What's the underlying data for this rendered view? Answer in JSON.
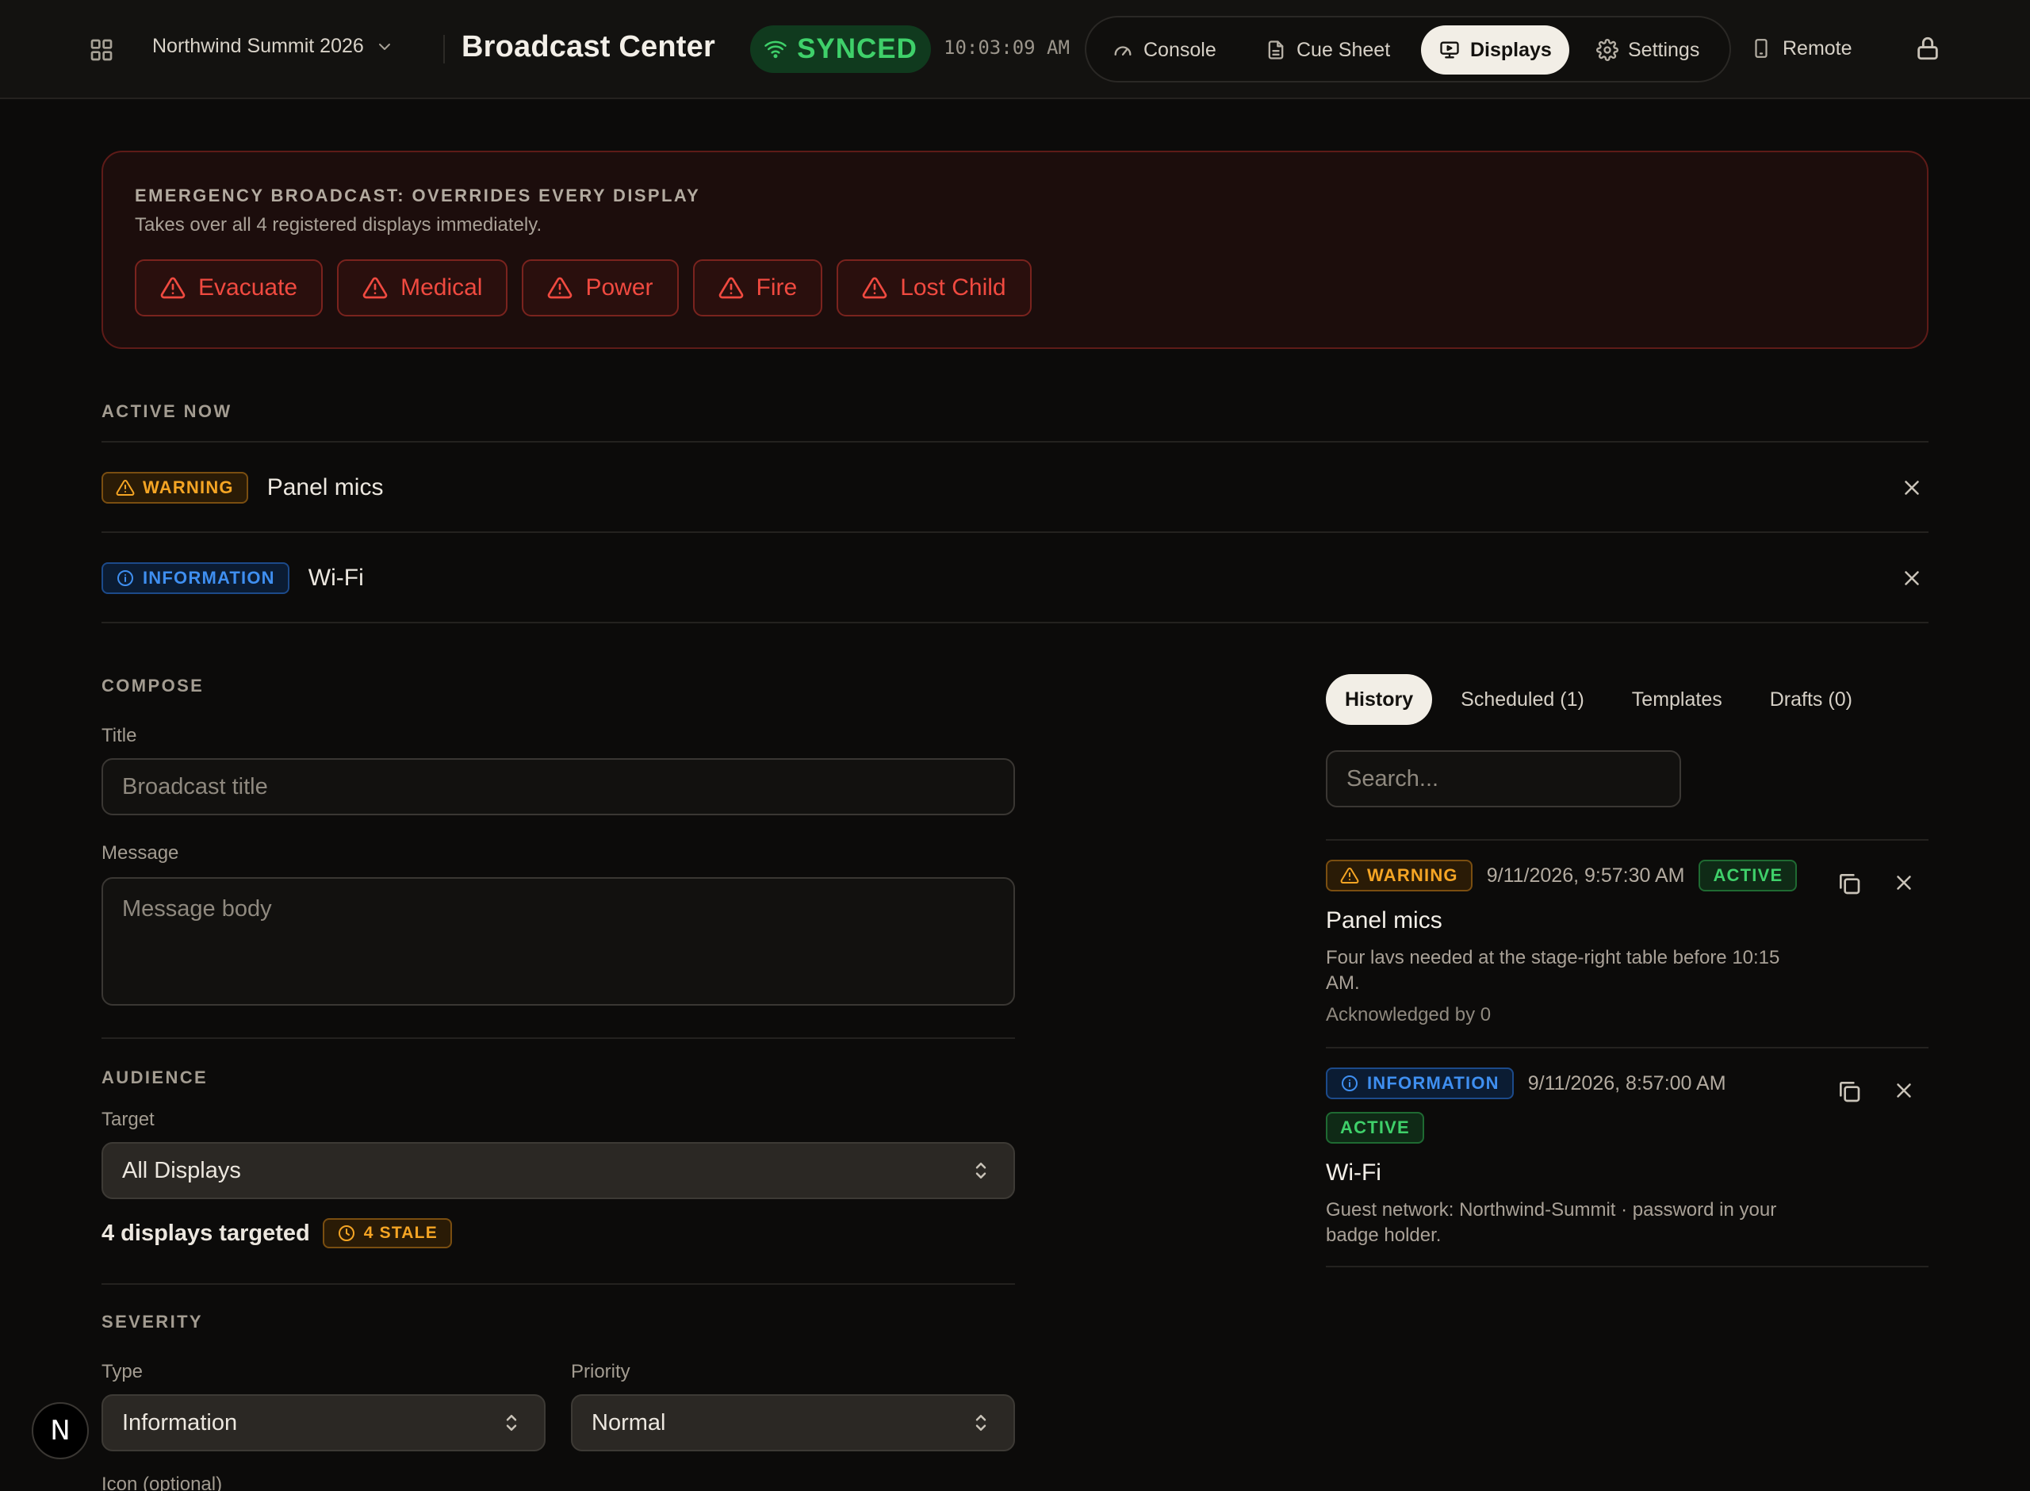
{
  "topbar": {
    "event_name": "Northwind Summit 2026",
    "title": "Broadcast Center",
    "sync_status": "SYNCED",
    "clock": "10:03:09 AM",
    "nav": [
      {
        "label": "Console",
        "icon": "gauge-icon"
      },
      {
        "label": "Cue Sheet",
        "icon": "document-icon"
      },
      {
        "label": "Displays",
        "icon": "monitor-icon",
        "active": true
      },
      {
        "label": "Settings",
        "icon": "gear-icon"
      }
    ],
    "remote_label": "Remote"
  },
  "emergency": {
    "title": "EMERGENCY BROADCAST: OVERRIDES EVERY DISPLAY",
    "subtitle": "Takes over all 4 registered displays immediately.",
    "buttons": [
      "Evacuate",
      "Medical",
      "Power",
      "Fire",
      "Lost Child"
    ],
    "color": "#f04a40"
  },
  "active_now": {
    "label": "ACTIVE NOW",
    "items": [
      {
        "badge": "WARNING",
        "name": "Panel mics"
      },
      {
        "badge": "INFORMATION",
        "name": "Wi-Fi"
      }
    ]
  },
  "compose": {
    "label": "COMPOSE",
    "title_label": "Title",
    "title_placeholder": "Broadcast title",
    "message_label": "Message",
    "message_placeholder": "Message body"
  },
  "audience": {
    "label": "AUDIENCE",
    "target_label": "Target",
    "target_value": "All Displays",
    "targeted_text": "4 displays targeted",
    "stale_badge": "4 STALE"
  },
  "severity": {
    "label": "SEVERITY",
    "type_label": "Type",
    "type_value": "Information",
    "priority_label": "Priority",
    "priority_value": "Normal",
    "icon_label": "Icon (optional)"
  },
  "history_panel": {
    "tabs": [
      "History",
      "Scheduled (1)",
      "Templates",
      "Drafts (0)"
    ],
    "search_placeholder": "Search...",
    "items": [
      {
        "badge": "WARNING",
        "time": "9/11/2026, 9:57:30 AM",
        "status": "ACTIVE",
        "title": "Panel mics",
        "body": "Four lavs needed at the stage-right table before 10:15 AM.",
        "ack": "Acknowledged by 0"
      },
      {
        "badge": "INFORMATION",
        "time": "9/11/2026, 8:57:00 AM",
        "status": "ACTIVE",
        "title": "Wi-Fi",
        "body": "Guest network: Northwind-Summit · password in your badge holder."
      }
    ]
  },
  "fab_label": "N",
  "colors": {
    "background": "#0c0b0a",
    "warning": "#f5a524",
    "information": "#3f8ff0",
    "active": "#3fd06a",
    "danger": "#f04a40"
  }
}
